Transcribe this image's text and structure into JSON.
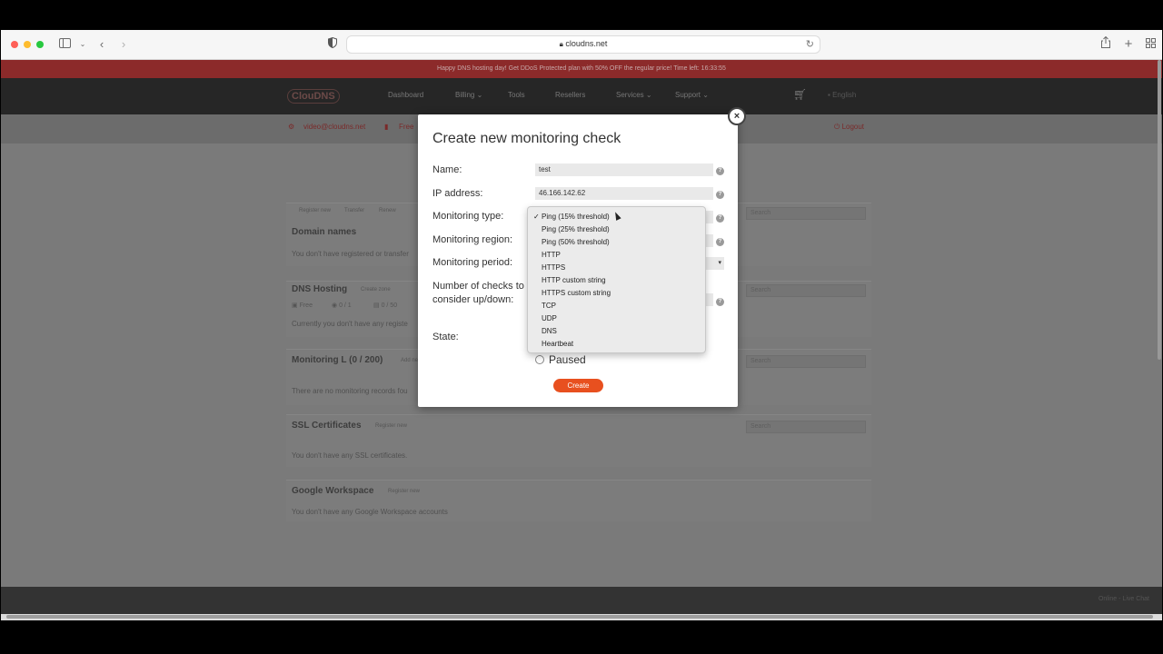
{
  "browser": {
    "url": "cloudns.net",
    "icons": {
      "sidebar": "sidebar-icon",
      "back": "chevron-left-icon",
      "forward": "chevron-right-icon",
      "shield": "privacy-shield-icon",
      "lock": "lock-icon",
      "reload": "reload-icon",
      "share": "share-icon",
      "new_tab": "plus-icon",
      "tabs": "tab-overview-icon"
    }
  },
  "site": {
    "promo": "Happy DNS hosting day! Get DDoS Protected plan with 50% OFF the regular price! Time left: 16:33:55",
    "logo": "ClouDNS",
    "nav": [
      "Dashboard",
      "Billing",
      "Tools",
      "Resellers",
      "Services",
      "Support"
    ],
    "language": "English",
    "user_email": "video@cloudns.net",
    "plan_label": "Free",
    "logout": "Logout"
  },
  "panels": {
    "domain_names": {
      "title": "Domain names",
      "tabs": [
        "Register new",
        "Transfer",
        "Renew"
      ],
      "text": "You don't have registered or transfer",
      "search": "Search"
    },
    "dns_hosting": {
      "title": "DNS Hosting",
      "tab": "Create zone",
      "stats": [
        "Free",
        "0 / 1",
        "0 / 50"
      ],
      "text": "Currently you don't have any registe",
      "search": "Search"
    },
    "monitoring": {
      "title": "Monitoring L (0 / 200)",
      "tab": "Add ne",
      "text": "There are no monitoring records fou",
      "search": "Search"
    },
    "ssl": {
      "title": "SSL Certificates",
      "tab": "Register new",
      "text": "You don't have any SSL certificates.",
      "search": "Search"
    },
    "workspace": {
      "title": "Google Workspace",
      "tab": "Register new",
      "text": "You don't have any Google Workspace accounts"
    }
  },
  "footer": {
    "chat": "Online - Live Chat"
  },
  "modal": {
    "title": "Create new monitoring check",
    "close": "×",
    "name_label": "Name:",
    "name_value": "test",
    "ip_label": "IP address:",
    "ip_value": "46.166.142.62",
    "type_label": "Monitoring type:",
    "region_label": "Monitoring region:",
    "period_label": "Monitoring period:",
    "checks_label": "Number of checks to consider up/down:",
    "state_label": "State:",
    "paused_label": "Paused",
    "create_label": "Create",
    "help_glyph": "?"
  },
  "dropdown": {
    "selected_index": 0,
    "check": "✓",
    "options": [
      "Ping (15% threshold)",
      "Ping (25% threshold)",
      "Ping (50% threshold)",
      "HTTP",
      "HTTPS",
      "HTTP custom string",
      "HTTPS custom string",
      "TCP",
      "UDP",
      "DNS",
      "Heartbeat"
    ]
  },
  "colors": {
    "accent": "#e8501f",
    "promo": "#8c2a2a"
  }
}
